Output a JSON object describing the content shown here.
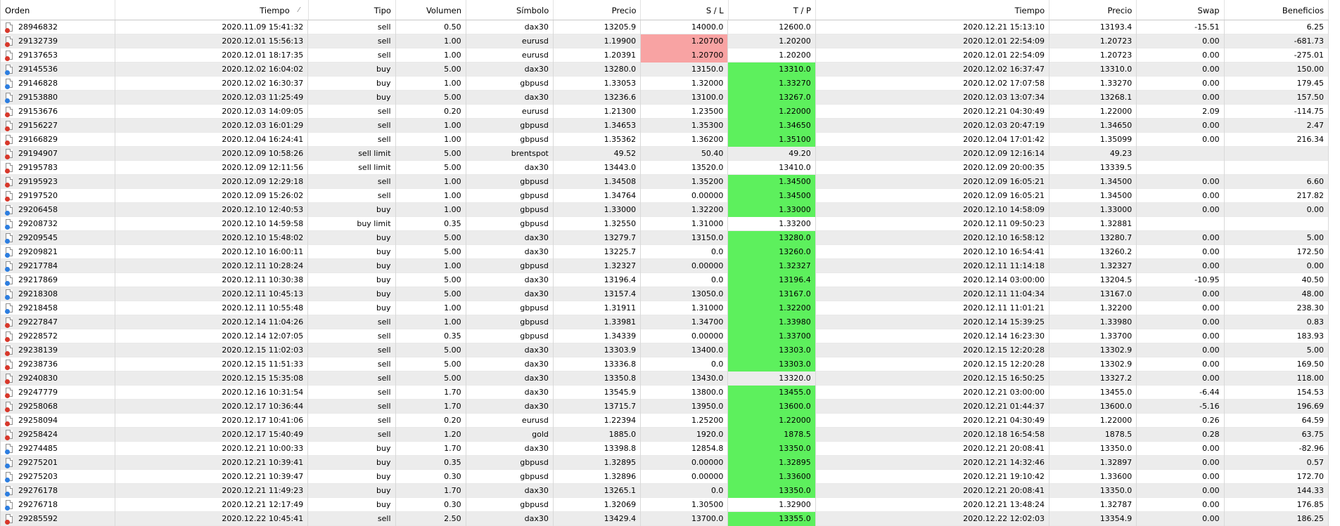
{
  "columns": [
    "Orden",
    "Tiempo",
    "Tipo",
    "Volumen",
    "Símbolo",
    "Precio",
    "S / L",
    "T / P",
    "Tiempo",
    "Precio",
    "Swap",
    "Beneficios"
  ],
  "sort_indicator": "⁄",
  "colors": {
    "sl_hit": "#f8a3a3",
    "tp_hit": "#5df05d",
    "sell_icon": "#d8382b",
    "buy_icon": "#2d7ee0"
  },
  "rows": [
    {
      "order": "28946832",
      "time": "2020.11.09 15:41:32",
      "type": "sell",
      "volume": "0.50",
      "symbol": "dax30",
      "price": "13205.9",
      "sl": "14000.0",
      "tp": "12600.0",
      "close_time": "2020.12.21 15:13:10",
      "close_price": "13193.4",
      "swap": "-15.51",
      "profit": "6.25",
      "sl_hl": false,
      "tp_hl": false
    },
    {
      "order": "29132739",
      "time": "2020.12.01 15:56:13",
      "type": "sell",
      "volume": "1.00",
      "symbol": "eurusd",
      "price": "1.19900",
      "sl": "1.20700",
      "tp": "1.20200",
      "close_time": "2020.12.01 22:54:09",
      "close_price": "1.20723",
      "swap": "0.00",
      "profit": "-681.73",
      "sl_hl": true,
      "tp_hl": false
    },
    {
      "order": "29137653",
      "time": "2020.12.01 18:17:35",
      "type": "sell",
      "volume": "1.00",
      "symbol": "eurusd",
      "price": "1.20391",
      "sl": "1.20700",
      "tp": "1.20200",
      "close_time": "2020.12.01 22:54:09",
      "close_price": "1.20723",
      "swap": "0.00",
      "profit": "-275.01",
      "sl_hl": true,
      "tp_hl": false
    },
    {
      "order": "29145536",
      "time": "2020.12.02 16:04:02",
      "type": "buy",
      "volume": "5.00",
      "symbol": "dax30",
      "price": "13280.0",
      "sl": "13150.0",
      "tp": "13310.0",
      "close_time": "2020.12.02 16:37:47",
      "close_price": "13310.0",
      "swap": "0.00",
      "profit": "150.00",
      "sl_hl": false,
      "tp_hl": true
    },
    {
      "order": "29146828",
      "time": "2020.12.02 16:30:37",
      "type": "buy",
      "volume": "1.00",
      "symbol": "gbpusd",
      "price": "1.33053",
      "sl": "1.32000",
      "tp": "1.33270",
      "close_time": "2020.12.02 17:07:58",
      "close_price": "1.33270",
      "swap": "0.00",
      "profit": "179.45",
      "sl_hl": false,
      "tp_hl": true
    },
    {
      "order": "29153880",
      "time": "2020.12.03 11:25:49",
      "type": "buy",
      "volume": "5.00",
      "symbol": "dax30",
      "price": "13236.6",
      "sl": "13100.0",
      "tp": "13267.0",
      "close_time": "2020.12.03 13:07:34",
      "close_price": "13268.1",
      "swap": "0.00",
      "profit": "157.50",
      "sl_hl": false,
      "tp_hl": true
    },
    {
      "order": "29153676",
      "time": "2020.12.03 14:09:05",
      "type": "sell",
      "volume": "0.20",
      "symbol": "eurusd",
      "price": "1.21300",
      "sl": "1.23500",
      "tp": "1.22000",
      "close_time": "2020.12.21 04:30:49",
      "close_price": "1.22000",
      "swap": "2.09",
      "profit": "-114.75",
      "sl_hl": false,
      "tp_hl": true
    },
    {
      "order": "29156227",
      "time": "2020.12.03 16:01:29",
      "type": "sell",
      "volume": "1.00",
      "symbol": "gbpusd",
      "price": "1.34653",
      "sl": "1.35300",
      "tp": "1.34650",
      "close_time": "2020.12.03 20:47:19",
      "close_price": "1.34650",
      "swap": "0.00",
      "profit": "2.47",
      "sl_hl": false,
      "tp_hl": true
    },
    {
      "order": "29166829",
      "time": "2020.12.04 16:24:41",
      "type": "sell",
      "volume": "1.00",
      "symbol": "gbpusd",
      "price": "1.35362",
      "sl": "1.36200",
      "tp": "1.35100",
      "close_time": "2020.12.04 17:01:42",
      "close_price": "1.35099",
      "swap": "0.00",
      "profit": "216.34",
      "sl_hl": false,
      "tp_hl": true
    },
    {
      "order": "29194907",
      "time": "2020.12.09 10:58:26",
      "type": "sell limit",
      "volume": "5.00",
      "symbol": "brentspot",
      "price": "49.52",
      "sl": "50.40",
      "tp": "49.20",
      "close_time": "2020.12.09 12:16:14",
      "close_price": "49.23",
      "swap": "",
      "profit": "",
      "sl_hl": false,
      "tp_hl": false
    },
    {
      "order": "29195783",
      "time": "2020.12.09 12:11:56",
      "type": "sell limit",
      "volume": "5.00",
      "symbol": "dax30",
      "price": "13443.0",
      "sl": "13520.0",
      "tp": "13410.0",
      "close_time": "2020.12.09 20:00:35",
      "close_price": "13339.5",
      "swap": "",
      "profit": "",
      "sl_hl": false,
      "tp_hl": false
    },
    {
      "order": "29195923",
      "time": "2020.12.09 12:29:18",
      "type": "sell",
      "volume": "1.00",
      "symbol": "gbpusd",
      "price": "1.34508",
      "sl": "1.35200",
      "tp": "1.34500",
      "close_time": "2020.12.09 16:05:21",
      "close_price": "1.34500",
      "swap": "0.00",
      "profit": "6.60",
      "sl_hl": false,
      "tp_hl": true
    },
    {
      "order": "29197520",
      "time": "2020.12.09 15:26:02",
      "type": "sell",
      "volume": "1.00",
      "symbol": "gbpusd",
      "price": "1.34764",
      "sl": "0.00000",
      "tp": "1.34500",
      "close_time": "2020.12.09 16:05:21",
      "close_price": "1.34500",
      "swap": "0.00",
      "profit": "217.82",
      "sl_hl": false,
      "tp_hl": true
    },
    {
      "order": "29206458",
      "time": "2020.12.10 12:40:53",
      "type": "buy",
      "volume": "1.00",
      "symbol": "gbpusd",
      "price": "1.33000",
      "sl": "1.32200",
      "tp": "1.33000",
      "close_time": "2020.12.10 14:58:09",
      "close_price": "1.33000",
      "swap": "0.00",
      "profit": "0.00",
      "sl_hl": false,
      "tp_hl": true
    },
    {
      "order": "29208732",
      "time": "2020.12.10 14:59:58",
      "type": "buy limit",
      "volume": "0.35",
      "symbol": "gbpusd",
      "price": "1.32550",
      "sl": "1.31000",
      "tp": "1.33200",
      "close_time": "2020.12.11 09:50:23",
      "close_price": "1.32881",
      "swap": "",
      "profit": "",
      "sl_hl": false,
      "tp_hl": false
    },
    {
      "order": "29209545",
      "time": "2020.12.10 15:48:02",
      "type": "buy",
      "volume": "5.00",
      "symbol": "dax30",
      "price": "13279.7",
      "sl": "13150.0",
      "tp": "13280.0",
      "close_time": "2020.12.10 16:58:12",
      "close_price": "13280.7",
      "swap": "0.00",
      "profit": "5.00",
      "sl_hl": false,
      "tp_hl": true
    },
    {
      "order": "29209821",
      "time": "2020.12.10 16:00:11",
      "type": "buy",
      "volume": "5.00",
      "symbol": "dax30",
      "price": "13225.7",
      "sl": "0.0",
      "tp": "13260.0",
      "close_time": "2020.12.10 16:54:41",
      "close_price": "13260.2",
      "swap": "0.00",
      "profit": "172.50",
      "sl_hl": false,
      "tp_hl": true
    },
    {
      "order": "29217784",
      "time": "2020.12.11 10:28:24",
      "type": "buy",
      "volume": "1.00",
      "symbol": "gbpusd",
      "price": "1.32327",
      "sl": "0.00000",
      "tp": "1.32327",
      "close_time": "2020.12.11 11:14:18",
      "close_price": "1.32327",
      "swap": "0.00",
      "profit": "0.00",
      "sl_hl": false,
      "tp_hl": true
    },
    {
      "order": "29217869",
      "time": "2020.12.11 10:30:38",
      "type": "buy",
      "volume": "5.00",
      "symbol": "dax30",
      "price": "13196.4",
      "sl": "0.0",
      "tp": "13196.4",
      "close_time": "2020.12.14 03:00:00",
      "close_price": "13204.5",
      "swap": "-10.95",
      "profit": "40.50",
      "sl_hl": false,
      "tp_hl": true
    },
    {
      "order": "29218308",
      "time": "2020.12.11 10:45:13",
      "type": "buy",
      "volume": "5.00",
      "symbol": "dax30",
      "price": "13157.4",
      "sl": "13050.0",
      "tp": "13167.0",
      "close_time": "2020.12.11 11:04:34",
      "close_price": "13167.0",
      "swap": "0.00",
      "profit": "48.00",
      "sl_hl": false,
      "tp_hl": true
    },
    {
      "order": "29218458",
      "time": "2020.12.11 10:55:48",
      "type": "buy",
      "volume": "1.00",
      "symbol": "gbpusd",
      "price": "1.31911",
      "sl": "1.31000",
      "tp": "1.32200",
      "close_time": "2020.12.11 11:01:21",
      "close_price": "1.32200",
      "swap": "0.00",
      "profit": "238.30",
      "sl_hl": false,
      "tp_hl": true
    },
    {
      "order": "29227847",
      "time": "2020.12.14 11:04:26",
      "type": "sell",
      "volume": "1.00",
      "symbol": "gbpusd",
      "price": "1.33981",
      "sl": "1.34700",
      "tp": "1.33980",
      "close_time": "2020.12.14 15:39:25",
      "close_price": "1.33980",
      "swap": "0.00",
      "profit": "0.83",
      "sl_hl": false,
      "tp_hl": true
    },
    {
      "order": "29228572",
      "time": "2020.12.14 12:07:05",
      "type": "sell",
      "volume": "0.35",
      "symbol": "gbpusd",
      "price": "1.34339",
      "sl": "0.00000",
      "tp": "1.33700",
      "close_time": "2020.12.14 16:23:30",
      "close_price": "1.33700",
      "swap": "0.00",
      "profit": "183.93",
      "sl_hl": false,
      "tp_hl": true
    },
    {
      "order": "29238139",
      "time": "2020.12.15 11:02:03",
      "type": "sell",
      "volume": "5.00",
      "symbol": "dax30",
      "price": "13303.9",
      "sl": "13400.0",
      "tp": "13303.0",
      "close_time": "2020.12.15 12:20:28",
      "close_price": "13302.9",
      "swap": "0.00",
      "profit": "5.00",
      "sl_hl": false,
      "tp_hl": true
    },
    {
      "order": "29238736",
      "time": "2020.12.15 11:51:33",
      "type": "sell",
      "volume": "5.00",
      "symbol": "dax30",
      "price": "13336.8",
      "sl": "0.0",
      "tp": "13303.0",
      "close_time": "2020.12.15 12:20:28",
      "close_price": "13302.9",
      "swap": "0.00",
      "profit": "169.50",
      "sl_hl": false,
      "tp_hl": true
    },
    {
      "order": "29240830",
      "time": "2020.12.15 15:35:08",
      "type": "sell",
      "volume": "5.00",
      "symbol": "dax30",
      "price": "13350.8",
      "sl": "13430.0",
      "tp": "13320.0",
      "close_time": "2020.12.15 16:50:25",
      "close_price": "13327.2",
      "swap": "0.00",
      "profit": "118.00",
      "sl_hl": false,
      "tp_hl": false
    },
    {
      "order": "29247779",
      "time": "2020.12.16 10:31:54",
      "type": "sell",
      "volume": "1.70",
      "symbol": "dax30",
      "price": "13545.9",
      "sl": "13800.0",
      "tp": "13455.0",
      "close_time": "2020.12.21 03:00:00",
      "close_price": "13455.0",
      "swap": "-6.44",
      "profit": "154.53",
      "sl_hl": false,
      "tp_hl": true
    },
    {
      "order": "29258068",
      "time": "2020.12.17 10:36:44",
      "type": "sell",
      "volume": "1.70",
      "symbol": "dax30",
      "price": "13715.7",
      "sl": "13950.0",
      "tp": "13600.0",
      "close_time": "2020.12.21 01:44:37",
      "close_price": "13600.0",
      "swap": "-5.16",
      "profit": "196.69",
      "sl_hl": false,
      "tp_hl": true
    },
    {
      "order": "29258094",
      "time": "2020.12.17 10:41:06",
      "type": "sell",
      "volume": "0.20",
      "symbol": "eurusd",
      "price": "1.22394",
      "sl": "1.25200",
      "tp": "1.22000",
      "close_time": "2020.12.21 04:30:49",
      "close_price": "1.22000",
      "swap": "0.26",
      "profit": "64.59",
      "sl_hl": false,
      "tp_hl": true
    },
    {
      "order": "29258424",
      "time": "2020.12.17 15:40:49",
      "type": "sell",
      "volume": "1.20",
      "symbol": "gold",
      "price": "1885.0",
      "sl": "1920.0",
      "tp": "1878.5",
      "close_time": "2020.12.18 16:54:58",
      "close_price": "1878.5",
      "swap": "0.28",
      "profit": "63.75",
      "sl_hl": false,
      "tp_hl": true
    },
    {
      "order": "29274485",
      "time": "2020.12.21 10:00:33",
      "type": "buy",
      "volume": "1.70",
      "symbol": "dax30",
      "price": "13398.8",
      "sl": "12854.8",
      "tp": "13350.0",
      "close_time": "2020.12.21 20:08:41",
      "close_price": "13350.0",
      "swap": "0.00",
      "profit": "-82.96",
      "sl_hl": false,
      "tp_hl": true
    },
    {
      "order": "29275201",
      "time": "2020.12.21 10:39:41",
      "type": "buy",
      "volume": "0.35",
      "symbol": "gbpusd",
      "price": "1.32895",
      "sl": "0.00000",
      "tp": "1.32895",
      "close_time": "2020.12.21 14:32:46",
      "close_price": "1.32897",
      "swap": "0.00",
      "profit": "0.57",
      "sl_hl": false,
      "tp_hl": true
    },
    {
      "order": "29275203",
      "time": "2020.12.21 10:39:47",
      "type": "buy",
      "volume": "0.30",
      "symbol": "gbpusd",
      "price": "1.32896",
      "sl": "0.00000",
      "tp": "1.33600",
      "close_time": "2020.12.21 19:10:42",
      "close_price": "1.33600",
      "swap": "0.00",
      "profit": "172.70",
      "sl_hl": false,
      "tp_hl": true
    },
    {
      "order": "29276178",
      "time": "2020.12.21 11:49:23",
      "type": "buy",
      "volume": "1.70",
      "symbol": "dax30",
      "price": "13265.1",
      "sl": "0.0",
      "tp": "13350.0",
      "close_time": "2020.12.21 20:08:41",
      "close_price": "13350.0",
      "swap": "0.00",
      "profit": "144.33",
      "sl_hl": false,
      "tp_hl": true
    },
    {
      "order": "29276718",
      "time": "2020.12.21 12:17:49",
      "type": "buy",
      "volume": "0.30",
      "symbol": "gbpusd",
      "price": "1.32069",
      "sl": "1.30500",
      "tp": "1.32900",
      "close_time": "2020.12.21 13:48:24",
      "close_price": "1.32787",
      "swap": "0.00",
      "profit": "176.85",
      "sl_hl": false,
      "tp_hl": false
    },
    {
      "order": "29285592",
      "time": "2020.12.22 10:45:41",
      "type": "sell",
      "volume": "2.50",
      "symbol": "dax30",
      "price": "13429.4",
      "sl": "13700.0",
      "tp": "13355.0",
      "close_time": "2020.12.22 12:02:03",
      "close_price": "13354.9",
      "swap": "0.00",
      "profit": "186.25",
      "sl_hl": false,
      "tp_hl": true
    }
  ]
}
